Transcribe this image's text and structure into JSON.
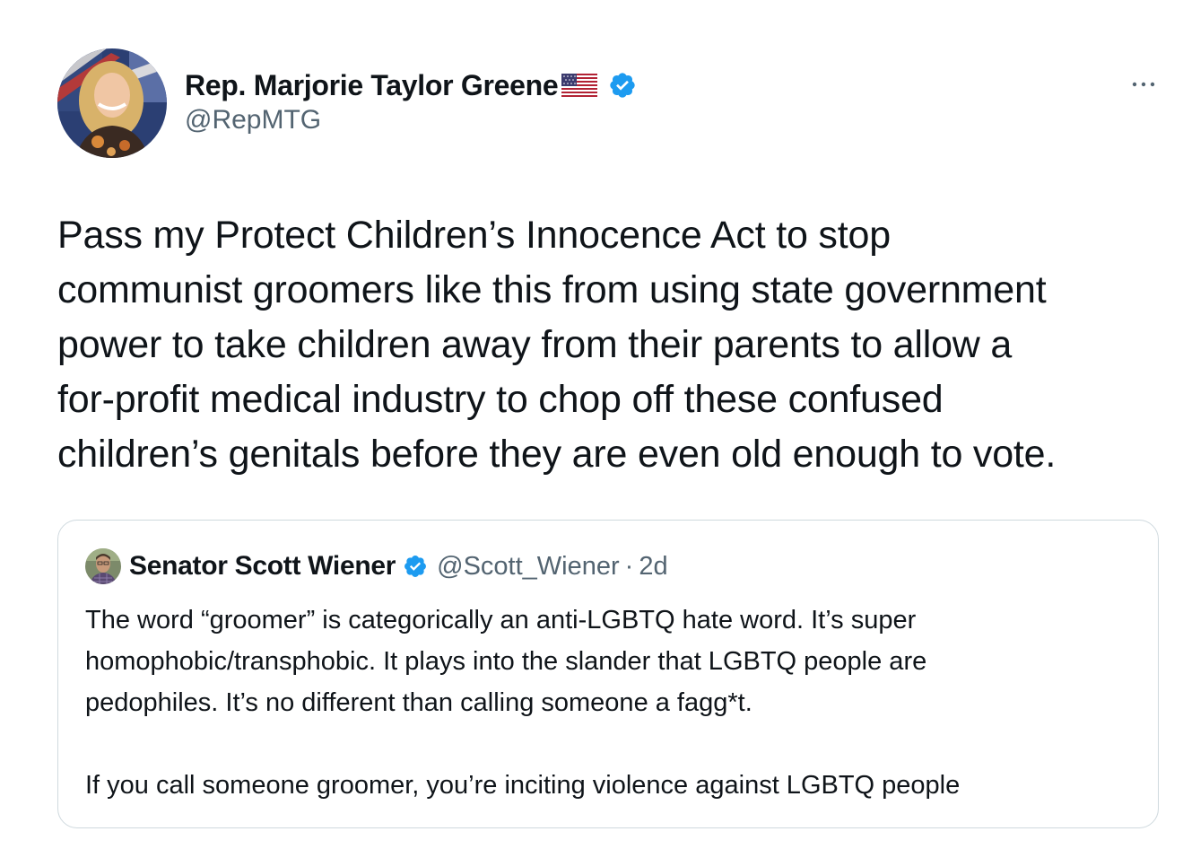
{
  "tweet": {
    "author": {
      "name": "Rep. Marjorie Taylor Greene",
      "flag_icon": "us-flag-icon",
      "verified_icon": "verified-badge-icon",
      "handle": "@RepMTG"
    },
    "more_icon": "more-options-icon",
    "text": "Pass my Protect Children’s Innocence Act to stop\ncommunist groomers like this from using state government\npower to take children away from their parents to allow a\nfor-profit medical industry to chop off these confused\nchildren’s genitals before they are even old enough to vote."
  },
  "quote": {
    "author": {
      "name": "Senator Scott Wiener",
      "verified_icon": "verified-badge-icon",
      "handle": "@Scott_Wiener",
      "separator": "·",
      "time": "2d"
    },
    "text": "The word “groomer” is categorically an anti-LGBTQ hate word. It’s super\nhomophobic/transphobic. It plays into the slander that LGBTQ people are\npedophiles. It’s no different than calling someone a fagg*t.\n\nIf you call someone groomer, you’re inciting violence against LGBTQ people"
  },
  "colors": {
    "text_primary": "#0f1419",
    "text_secondary": "#536471",
    "verified_blue": "#1d9bf0",
    "border": "#cfd9de"
  }
}
